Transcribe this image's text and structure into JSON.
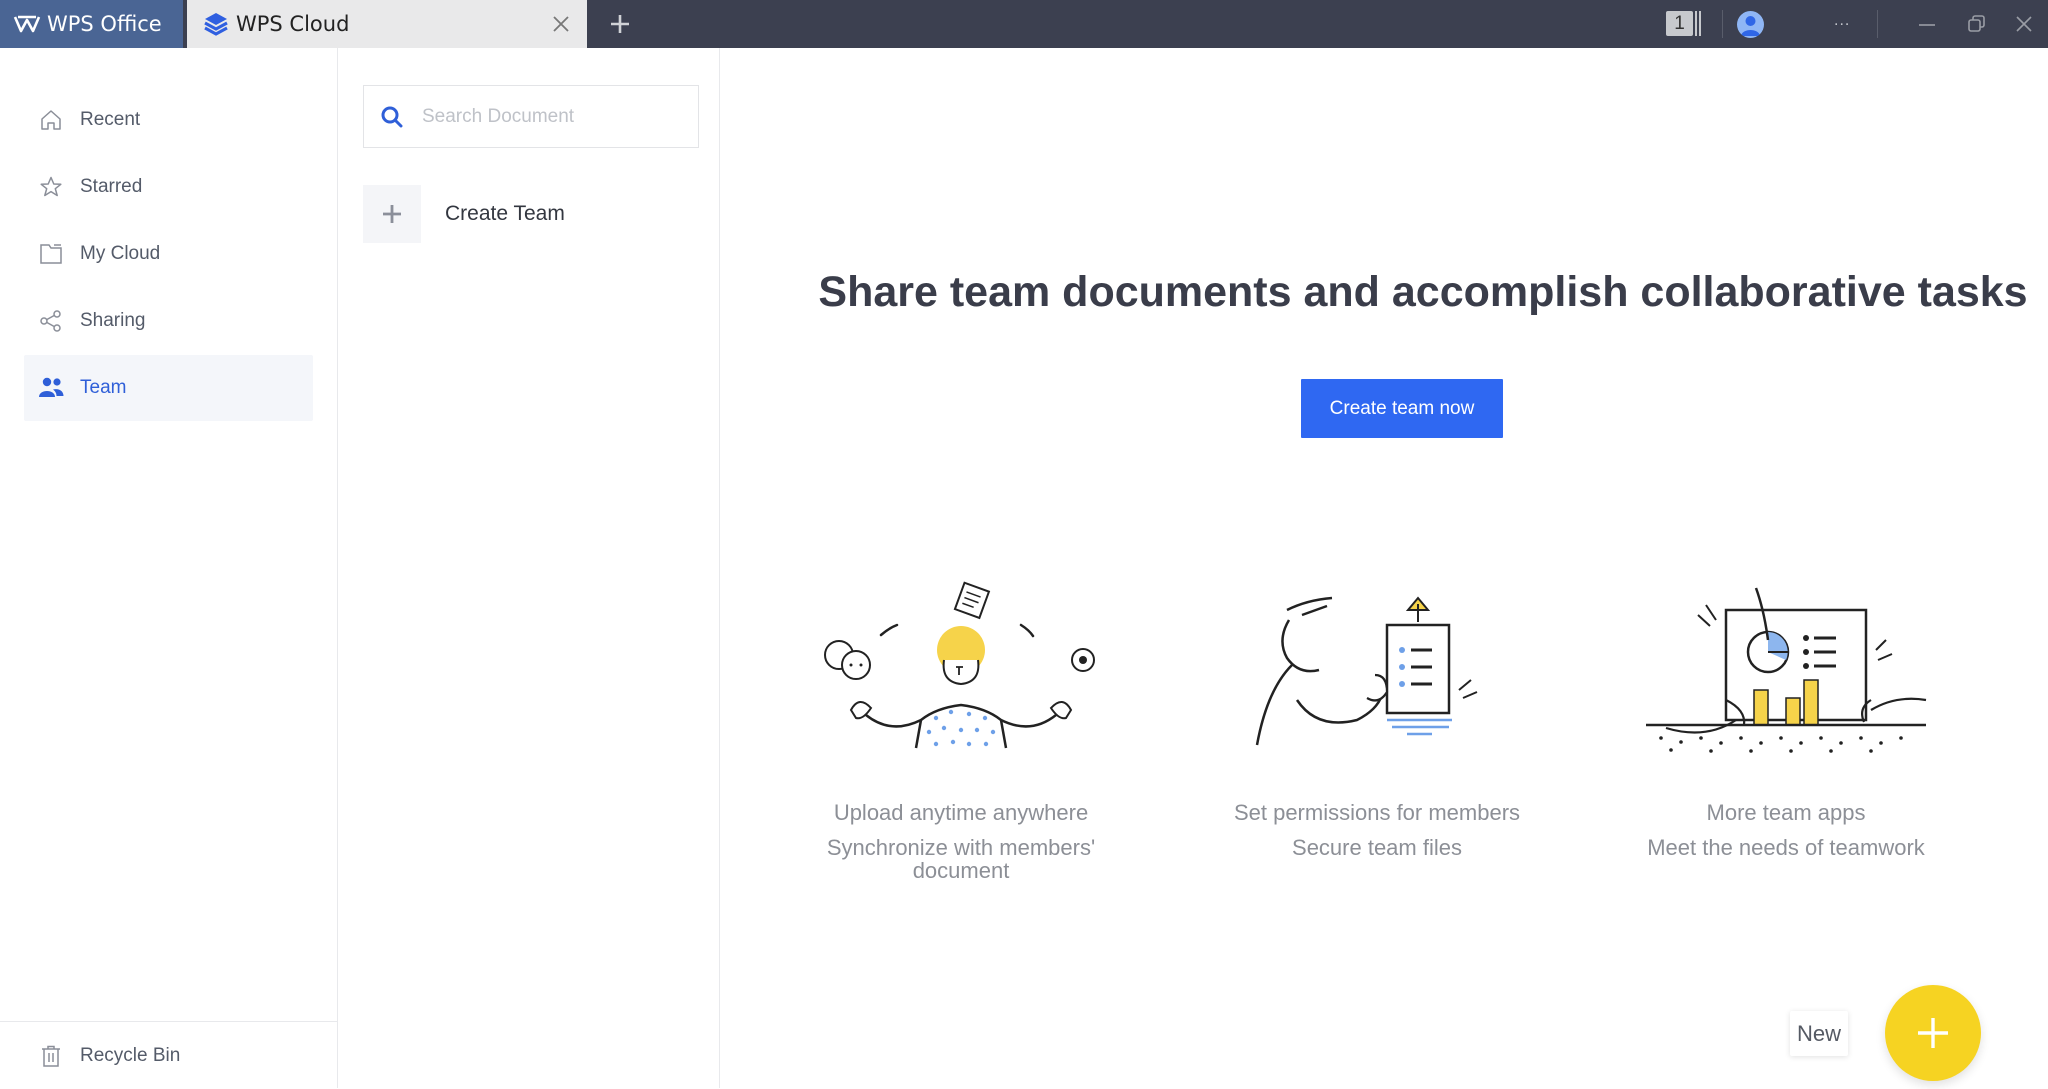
{
  "titlebar": {
    "tabs": [
      {
        "label": "WPS Office",
        "icon": "wps-logo-icon",
        "active": false
      },
      {
        "label": "WPS Cloud",
        "icon": "wps-cloud-logo-icon",
        "active": true
      }
    ],
    "window_count_badge": "1",
    "more_label": "...",
    "colors": {
      "bar": "#3c4050",
      "office_tab": "#4a6594",
      "active_tab": "#e9e9ea"
    }
  },
  "sidebar": {
    "items": [
      {
        "label": "Recent",
        "icon": "home-icon",
        "active": false
      },
      {
        "label": "Starred",
        "icon": "star-icon",
        "active": false
      },
      {
        "label": "My Cloud",
        "icon": "folder-icon",
        "active": false
      },
      {
        "label": "Sharing",
        "icon": "share-icon",
        "active": false
      },
      {
        "label": "Team",
        "icon": "team-icon",
        "active": true
      }
    ],
    "recycle_bin": {
      "label": "Recycle Bin",
      "icon": "trash-icon"
    }
  },
  "panel": {
    "search": {
      "placeholder": "Search Document",
      "value": ""
    },
    "create_team_label": "Create Team"
  },
  "main": {
    "headline": "Share team documents and accomplish collaborative tasks",
    "cta_label": "Create team now",
    "features": [
      {
        "title": "Upload anytime anywhere",
        "subtitle": "Synchronize with members' document",
        "illustration": "juggling-person-illustration"
      },
      {
        "title": "Set permissions for members",
        "subtitle": "Secure team files",
        "illustration": "person-holding-document-illustration"
      },
      {
        "title": "More team apps",
        "subtitle": "Meet the needs of teamwork",
        "illustration": "charts-board-illustration"
      }
    ],
    "new_label": "New",
    "accent_color": "#2f68f2",
    "fab_color": "#f6d322"
  }
}
